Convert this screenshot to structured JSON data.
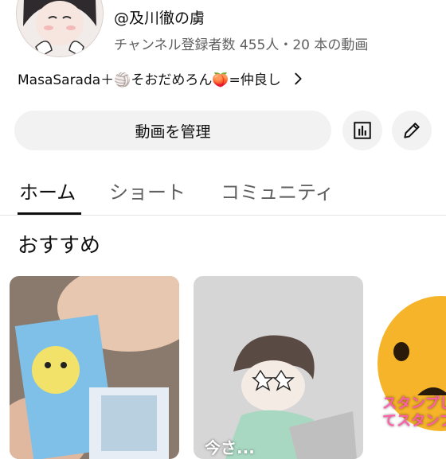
{
  "channel": {
    "handle": "@及川徹の虜",
    "stats": "チャンネル登録者数 455人・20 本の動画",
    "description": "MasaSarada＋🏐そおだめろん🍑=仲良し"
  },
  "actions": {
    "manage_label": "動画を管理",
    "analytics_icon": "bar-chart-icon",
    "edit_icon": "pencil-icon"
  },
  "tabs": [
    {
      "label": "ホーム",
      "active": true
    },
    {
      "label": "ショート",
      "active": false
    },
    {
      "label": "コミュニティ",
      "active": false
    }
  ],
  "section": {
    "title": "おすすめ"
  },
  "shorts": [
    {
      "caption": ""
    },
    {
      "caption": "今さ..."
    },
    {
      "caption": "スタンプしてスタンプ"
    }
  ]
}
